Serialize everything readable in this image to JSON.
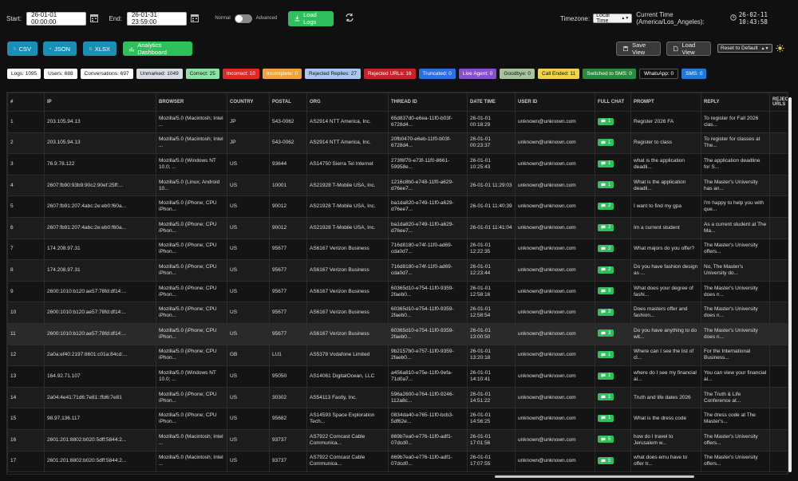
{
  "header": {
    "start_label": "Start:",
    "start_value": "26-01-01 00:00:00",
    "end_label": "End:",
    "end_value": "26-01-31 23:59:00",
    "mode_normal": "Normal",
    "mode_advanced": "Advanced",
    "load_logs_label": "Load Logs",
    "timezone_label": "Timezone:",
    "timezone_value": "Local Time",
    "current_time_label": "Current Time (America/Los_Angeles):",
    "current_time_value": "26-02-11 10:43:58"
  },
  "actions": {
    "csv": "CSV",
    "json": "JSON",
    "xlsx": "XLSX",
    "analytics": "Analytics Dashboard",
    "save_view": "Save View",
    "load_view": "Load View",
    "reset_default": "Reset to Default"
  },
  "chips": [
    {
      "label": "Logs: 1095",
      "bg": "#ffffff",
      "fg": "#111111"
    },
    {
      "label": "Users: 688",
      "bg": "#ffffff",
      "fg": "#111111"
    },
    {
      "label": "Conversations: 697",
      "bg": "#ffffff",
      "fg": "#111111"
    },
    {
      "label": "Unmarked: 1049",
      "bg": "#d8dde3",
      "fg": "#111111"
    },
    {
      "label": "Correct: 25",
      "bg": "#8fe0a5",
      "fg": "#111111"
    },
    {
      "label": "Incorrect: 10",
      "bg": "#e02a2a",
      "fg": "#ffffff"
    },
    {
      "label": "Incomplete: 0",
      "bg": "#f0a23a",
      "fg": "#ffffff"
    },
    {
      "label": "Rejected Replies: 27",
      "bg": "#a9c7ef",
      "fg": "#111111"
    },
    {
      "label": "Rejected URLs: 16",
      "bg": "#c8232a",
      "fg": "#ffffff"
    },
    {
      "label": "Truncated: 0",
      "bg": "#2b6fe0",
      "fg": "#ffffff"
    },
    {
      "label": "Live Agent: 0",
      "bg": "#8a4fd1",
      "fg": "#ffffff"
    },
    {
      "label": "Goodbye: 0",
      "bg": "#a7c39a",
      "fg": "#111111"
    },
    {
      "label": "Call Ended: 11",
      "bg": "#f0d24b",
      "fg": "#111111"
    },
    {
      "label": "Switched to SMS: 0",
      "bg": "#2b8a3e",
      "fg": "#ffffff"
    },
    {
      "label": "WhatsApp: 0",
      "bg": "#111111",
      "fg": "#ffffff"
    },
    {
      "label": "SMS: 0",
      "bg": "#1f7ad6",
      "fg": "#ffffff"
    }
  ],
  "columns": [
    "#",
    "IP",
    "BROWSER",
    "COUNTRY",
    "POSTAL",
    "ORG",
    "THREAD ID",
    "DATE TIME",
    "USER ID",
    "FULL CHAT",
    "PROMPT",
    "REPLY",
    "REJECT URLS"
  ],
  "rows": [
    {
      "n": "1",
      "ip": "203.105.94.13",
      "browser": "Mozilla/5.0 (Macintosh; Intel ...",
      "country": "JP",
      "postal": "543-0062",
      "org": "AS2914 NTT America, Inc.",
      "thread": "65d837d0-e6ea-11f0-b03f-6728d4...",
      "dt": "26-01-01 00:18:29",
      "user": "unknown@unknown.com",
      "chat": "1",
      "prompt": "Register 2026 FA",
      "reply": "To register for Fall 2026 clas..."
    },
    {
      "n": "2",
      "ip": "203.105.94.13",
      "browser": "Mozilla/5.0 (Macintosh; Intel ...",
      "country": "JP",
      "postal": "543-0062",
      "org": "AS2914 NTT America, Inc.",
      "thread": "20fb0470-e6eb-11f0-b03f-6728d4...",
      "dt": "26-01-01 00:23:37",
      "user": "unknown@unknown.com",
      "chat": "1",
      "prompt": "Register to class",
      "reply": "To register for classes at The..."
    },
    {
      "n": "3",
      "ip": "76.9.78.122",
      "browser": "Mozilla/5.0 (Windows NT 10.0; ...",
      "country": "US",
      "postal": "93644",
      "org": "AS14750 Sierra Tel Internet",
      "thread": "273f6f70-e73f-11f0-8661-59958e...",
      "dt": "26-01-01 10:25:43",
      "user": "unknown@unknown.com",
      "chat": "1",
      "prompt": "what is the application deadli...",
      "reply": "The application deadline for S..."
    },
    {
      "n": "4",
      "ip": "2607:fb90:93b9:90c2:90ef:25ff:...",
      "browser": "Mozilla/5.0 (Linux; Android 10...",
      "country": "US",
      "postal": "10001",
      "org": "AS21928 T-Mobile USA, Inc.",
      "thread": "1216c8b0-e748-11f0-a629-d76ee7...",
      "dt": "26-01-01 11:29:03",
      "user": "unknown@unknown.com",
      "chat": "1",
      "prompt": "What is the application deadli...",
      "reply": "The Master's University has an..."
    },
    {
      "n": "5",
      "ip": "2607:fb91:207:4abc:2e:eb0:f60a...",
      "browser": "Mozilla/5.0 (iPhone; CPU iPhon...",
      "country": "US",
      "postal": "90012",
      "org": "AS21928 T-Mobile USA, Inc.",
      "thread": "ba1da820-e749-11f0-a629-d76ee7...",
      "dt": "26-01-01 11:40:39",
      "user": "unknown@unknown.com",
      "chat": "2",
      "prompt": "I want to find my gpa",
      "reply": "I'm happy to help you with que..."
    },
    {
      "n": "6",
      "ip": "2607:fb91:207:4abc:2e:eb0:f60a...",
      "browser": "Mozilla/5.0 (iPhone; CPU iPhon...",
      "country": "US",
      "postal": "90012",
      "org": "AS21928 T-Mobile USA, Inc.",
      "thread": "ba1da820-e749-11f0-a629-d76ee7...",
      "dt": "26-01-01 11:41:04",
      "user": "unknown@unknown.com",
      "chat": "2",
      "prompt": "Im a current student",
      "reply": "As a current student at The Ma..."
    },
    {
      "n": "7",
      "ip": "174.208.97.31",
      "browser": "Mozilla/5.0 (iPhone; CPU iPhon...",
      "country": "US",
      "postal": "95677",
      "org": "AS6167 Verizon Business",
      "thread": "716d8180-e74f-11f0-ad69-cda0d7...",
      "dt": "26-01-01 12:22:35",
      "user": "unknown@unknown.com",
      "chat": "2",
      "prompt": "What majors do you offer?",
      "reply": "The Master's University offers..."
    },
    {
      "n": "8",
      "ip": "174.208.97.31",
      "browser": "Mozilla/5.0 (iPhone; CPU iPhon...",
      "country": "US",
      "postal": "95677",
      "org": "AS6167 Verizon Business",
      "thread": "716d8180-e74f-11f0-ad69-cda0d7...",
      "dt": "26-01-01 12:23:44",
      "user": "unknown@unknown.com",
      "chat": "2",
      "prompt": "Do you have fashion design as ...",
      "reply": "No, The Master's University do..."
    },
    {
      "n": "9",
      "ip": "2600:1010:b120:ae57:78fd:df14:...",
      "browser": "Mozilla/5.0 (iPhone; CPU iPhon...",
      "country": "US",
      "postal": "95677",
      "org": "AS6167 Verizon Business",
      "thread": "60365d10-e754-11f0-9359-2faeb0...",
      "dt": "26-01-01 12:58:16",
      "user": "unknown@unknown.com",
      "chat": "3",
      "prompt": "What does your degree of fashi...",
      "reply": "The Master's University does n..."
    },
    {
      "n": "10",
      "ip": "2600:1010:b120:ae57:78fd:df14:...",
      "browser": "Mozilla/5.0 (iPhone; CPU iPhon...",
      "country": "US",
      "postal": "95677",
      "org": "AS6167 Verizon Business",
      "thread": "60365d10-e754-11f0-9359-2faeb0...",
      "dt": "26-01-01 12:58:54",
      "user": "unknown@unknown.com",
      "chat": "3",
      "prompt": "Does masters offer and fashion...",
      "reply": "The Master's University does n..."
    },
    {
      "n": "11",
      "ip": "2600:1010:b120:ae57:78fd:df14:...",
      "browser": "Mozilla/5.0 (iPhone; CPU iPhon...",
      "country": "US",
      "postal": "95677",
      "org": "AS6167 Verizon Business",
      "thread": "60365d10-e754-11f0-9359-2faeb0...",
      "dt": "26-01-01 13:00:50",
      "user": "unknown@unknown.com",
      "chat": "3",
      "prompt": "Do you have anything to do wit...",
      "reply": "The Master's University does n..."
    },
    {
      "n": "12",
      "ip": "2a0a:ef40:2197:8601:c01a:84cd:...",
      "browser": "Mozilla/5.0 (iPhone; CPU iPhon...",
      "country": "GB",
      "postal": "LU1",
      "org": "AS5378 Vodafone Limited",
      "thread": "9b2157b0-e757-11f0-9359-2faeb0...",
      "dt": "26-01-01 13:20:18",
      "user": "unknown@unknown.com",
      "chat": "1",
      "prompt": "Where can I see the list of cl...",
      "reply": "For the International Business..."
    },
    {
      "n": "13",
      "ip": "164.92.71.107",
      "browser": "Mozilla/5.0 (Windows NT 10.0; ...",
      "country": "US",
      "postal": "95050",
      "org": "AS14061 DigitalOcean, LLC",
      "thread": "a456a810-e75e-11f0-9efa-71d0a7...",
      "dt": "26-01-01 14:10:41",
      "user": "unknown@unknown.com",
      "chat": "1",
      "prompt": "where do I see my financial ai...",
      "reply": "You can view your financial ai..."
    },
    {
      "n": "14",
      "ip": "2a04:4e41:71d6:7e81::ffd6:7e81",
      "browser": "Mozilla/5.0 (iPhone; CPU iPhon...",
      "country": "US",
      "postal": "30302",
      "org": "AS54113 Fastly, Inc.",
      "thread": "596a2600-e764-11f0-9246-112a8c...",
      "dt": "26-01-01 14:51:22",
      "user": "unknown@unknown.com",
      "chat": "1",
      "prompt": "Truth and life dates 2026",
      "reply": "The Truth & Life Conference at..."
    },
    {
      "n": "15",
      "ip": "98.97.136.117",
      "browser": "Mozilla/5.0 (iPhone; CPU iPhon...",
      "country": "US",
      "postal": "95682",
      "org": "AS14593 Space Exploration Tech...",
      "thread": "0834da40-e765-11f0-bcb3-5df62e...",
      "dt": "26-01-01 14:56:25",
      "user": "unknown@unknown.com",
      "chat": "1",
      "prompt": "What is the dress code",
      "reply": "The dress code at The Master's..."
    },
    {
      "n": "16",
      "ip": "2601:201:8802:b020:5dff:5844:2...",
      "browser": "Mozilla/5.0 (Macintosh; Intel ...",
      "country": "US",
      "postal": "93737",
      "org": "AS7922 Comcast Cable Communica...",
      "thread": "869b7ea0-e776-11f0-adf1-07dcd0...",
      "dt": "26-01-01 17:01:56",
      "user": "unknown@unknown.com",
      "chat": "5",
      "prompt": "how do I travel to Jerusalem w...",
      "reply": "The Master's University offers..."
    },
    {
      "n": "17",
      "ip": "2601:201:8802:b020:5dff:5844:2...",
      "browser": "Mozilla/5.0 (Macintosh; Intel ...",
      "country": "US",
      "postal": "93737",
      "org": "AS7922 Comcast Cable Communica...",
      "thread": "869b7ea0-e776-11f0-adf1-07dcd0...",
      "dt": "26-01-01 17:07:55",
      "user": "unknown@unknown.com",
      "chat": "5",
      "prompt": "what does emu have to offer tr...",
      "reply": "The Master's University offers..."
    }
  ]
}
